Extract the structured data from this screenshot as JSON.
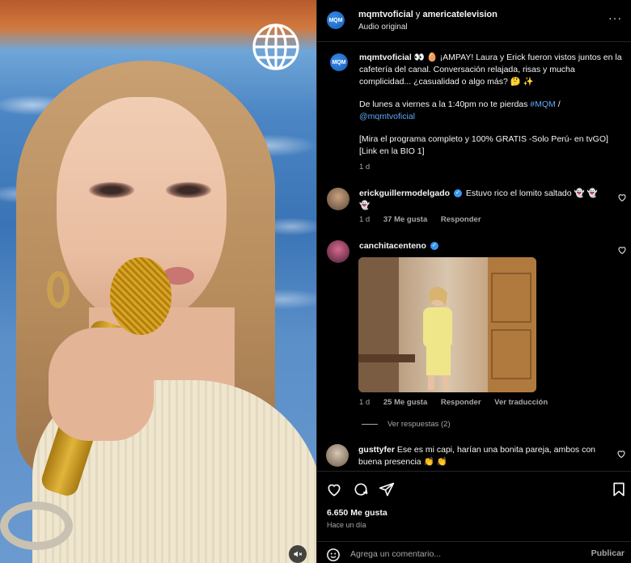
{
  "header": {
    "account": "mqmtvoficial",
    "connector": "y",
    "collaborator": "americatelevision",
    "audio": "Audio original",
    "more": "···",
    "avatar_text": "MQM"
  },
  "caption": {
    "author": "mqmtvoficial",
    "line1": "👀 🥚 ¡AMPAY! Laura y Erick fueron vistos juntos en la cafetería del canal. Conversación relajada, risas y mucha complicidad... ¿casualidad o algo más? 🤔 ✨",
    "line2_prefix": "De lunes a viernes a la 1:40pm no te pierdas",
    "hashtag": "#MQM",
    "slash": "/",
    "mention": "@mqmtvoficial",
    "line3": "[Mira el programa completo y 100% GRATIS -Solo Perú- en tvGO] [Link en la BIO 1]",
    "time": "1 d"
  },
  "comments": [
    {
      "user": "erickguillermodelgado",
      "text": "Estuvo rico el lomito saltado 👻 👻 👻",
      "time": "1 d",
      "likes": "37 Me gusta",
      "reply": "Responder"
    },
    {
      "user": "canchitacenteno",
      "text": "",
      "time": "1 d",
      "likes": "25 Me gusta",
      "reply": "Responder",
      "translate": "Ver traducción",
      "view_replies": "Ver respuestas (2)"
    },
    {
      "user": "gusttyfer",
      "text": "Ese es mi capi, harían una bonita pareja, ambos con buena presencia 👏 👏"
    }
  ],
  "actions": {
    "likes": "6.650 Me gusta",
    "ago": "Hace un día"
  },
  "composer": {
    "placeholder": "Agrega un comentario...",
    "post": "Publicar"
  },
  "colors": {
    "background": "#000000",
    "link": "#5ea9f7",
    "muted": "#a8a8a8",
    "verified": "#3897f0"
  }
}
